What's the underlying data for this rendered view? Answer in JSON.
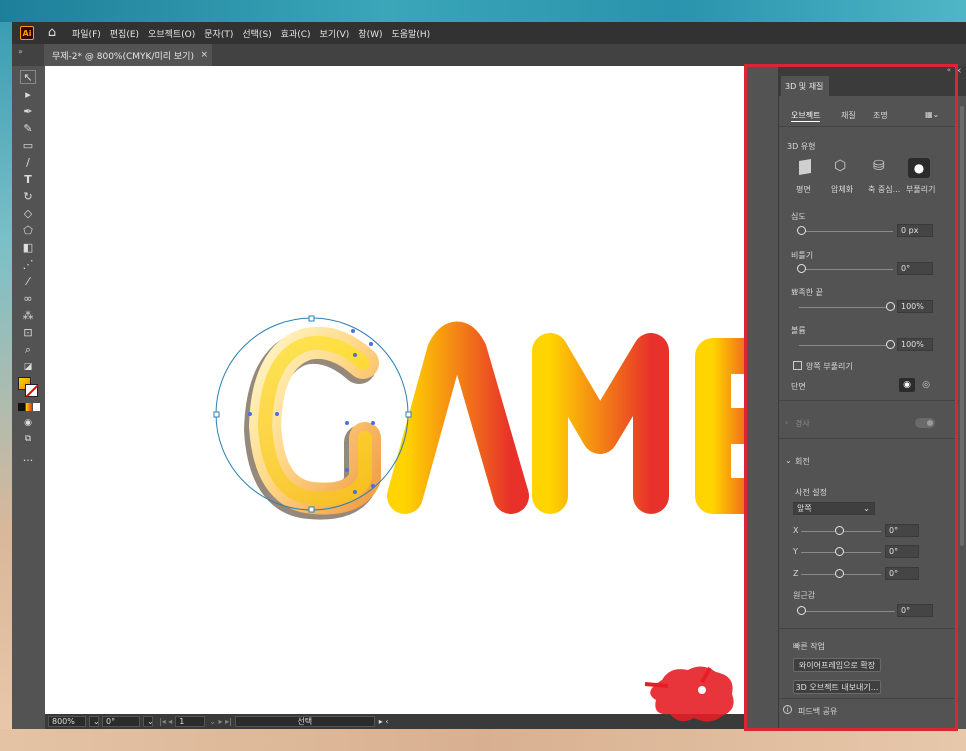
{
  "menubar": {
    "logo": "Ai",
    "items": [
      "파일(F)",
      "편집(E)",
      "오브젝트(O)",
      "문자(T)",
      "선택(S)",
      "효과(C)",
      "보기(V)",
      "창(W)",
      "도움말(H)"
    ]
  },
  "document_tab": {
    "title": "무제-2* @ 800%(CMYK/미리 보기)",
    "close": "×"
  },
  "canvas": {
    "artwork_text": "GAME",
    "letter_g": "G",
    "letters_ame": "AME"
  },
  "statusbar": {
    "zoom": "800%",
    "rotation": "0°",
    "artboard": "1",
    "mode": "선택"
  },
  "panel": {
    "title": "3D 및 재질",
    "tabs": [
      "오브젝트",
      "재질",
      "조명"
    ],
    "type_section": "3D 유형",
    "types": [
      "평면",
      "압체화",
      "축 중심...",
      "부풀리기"
    ],
    "depth": {
      "label": "심도",
      "value": "0 px",
      "fraction": 0.0
    },
    "twist": {
      "label": "비틀기",
      "value": "0°",
      "fraction": 0.0
    },
    "taper": {
      "label": "뾰족한 끝",
      "value": "100%",
      "fraction": 1.0
    },
    "volume": {
      "label": "볼륨",
      "value": "100%",
      "fraction": 1.0
    },
    "both_sides": {
      "label": "양쪽 부풀리기",
      "checked": false
    },
    "cap": {
      "label": "단면"
    },
    "bevel": {
      "label": "경사",
      "enabled": false
    },
    "rotation_section": "회전",
    "preset": {
      "label": "사전 설정",
      "value": "앞쪽"
    },
    "x": {
      "label": "X",
      "value": "0°",
      "fraction": 0.5
    },
    "y": {
      "label": "Y",
      "value": "0°",
      "fraction": 0.5
    },
    "z": {
      "label": "Z",
      "value": "0°",
      "fraction": 0.5
    },
    "perspective": {
      "label": "원근감",
      "value": "0°",
      "fraction": 0.0
    },
    "quick_actions": "빠른 작업",
    "expand_wireframe": "와이어프레임으로 확장",
    "export_3d": "3D 오브젝트 내보내기...",
    "feedback": "피드백 공유"
  },
  "colors": {
    "app_bg": "#535353",
    "menubar": "#323232",
    "highlight_box": "#d92631",
    "gradient_start": "#ffd400",
    "gradient_end": "#e8312a"
  }
}
